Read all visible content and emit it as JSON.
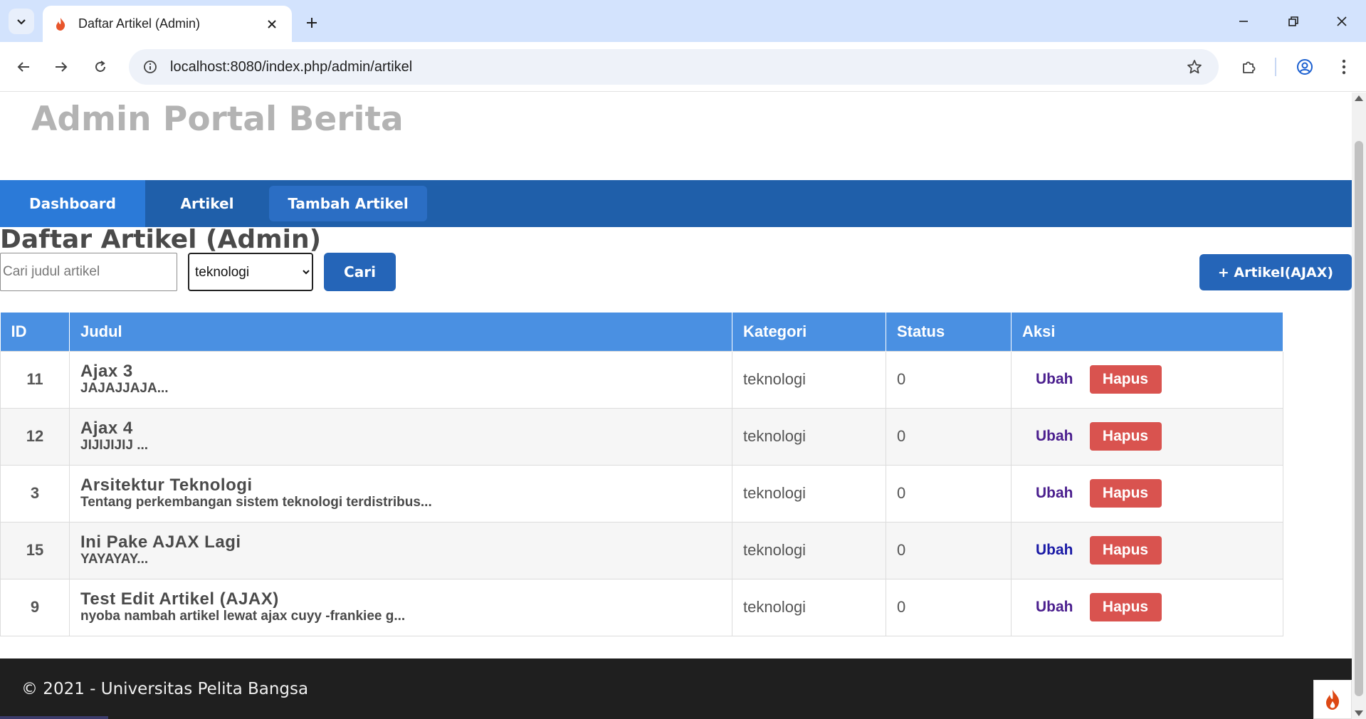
{
  "browser": {
    "tab_title": "Daftar Artikel (Admin)",
    "url": "localhost:8080/index.php/admin/artikel",
    "icons": {
      "tab_list": "chevron-down-icon",
      "favicon": "flame-icon",
      "close_tab": "close-icon",
      "new_tab": "plus-icon",
      "minimize": "minimize-icon",
      "restore": "restore-icon",
      "close_window": "close-icon",
      "back": "arrow-left-icon",
      "forward": "arrow-right-icon",
      "reload": "reload-icon",
      "site_info": "info-icon",
      "bookmark": "star-icon",
      "extensions": "puzzle-icon",
      "profile": "profile-icon",
      "menu": "more-vertical-icon"
    }
  },
  "site": {
    "title": "Admin Portal Berita"
  },
  "nav": {
    "dashboard": "Dashboard",
    "artikel": "Artikel",
    "tambah_artikel": "Tambah Artikel"
  },
  "page": {
    "heading": "Daftar Artikel (Admin)"
  },
  "filters": {
    "search_placeholder": "Cari judul artikel",
    "search_value": "",
    "category_selected": "teknologi",
    "search_button": "Cari",
    "add_ajax_button": "+ Artikel(AJAX)"
  },
  "table": {
    "headers": {
      "id": "ID",
      "judul": "Judul",
      "kategori": "Kategori",
      "status": "Status",
      "aksi": "Aksi"
    },
    "rows": [
      {
        "id": "11",
        "title": "Ajax 3",
        "excerpt": "JAJAJJAJA...",
        "kategori": "teknologi",
        "status": "0",
        "edit": "Ubah",
        "delete": "Hapus"
      },
      {
        "id": "12",
        "title": "Ajax 4",
        "excerpt": "JIJIJIJIJ ...",
        "kategori": "teknologi",
        "status": "0",
        "edit": "Ubah",
        "delete": "Hapus"
      },
      {
        "id": "3",
        "title": "Arsitektur Teknologi",
        "excerpt": "Tentang perkembangan sistem teknologi terdistribus...",
        "kategori": "teknologi",
        "status": "0",
        "edit": "Ubah",
        "delete": "Hapus"
      },
      {
        "id": "15",
        "title": "Ini Pake AJAX Lagi",
        "excerpt": "YAYAYAY...",
        "kategori": "teknologi",
        "status": "0",
        "edit": "Ubah",
        "delete": "Hapus"
      },
      {
        "id": "9",
        "title": "Test Edit Artikel (AJAX)",
        "excerpt": "nyoba nambah artikel lewat ajax cuyy -frankiee g...",
        "kategori": "teknologi",
        "status": "0",
        "edit": "Ubah",
        "delete": "Hapus"
      }
    ]
  },
  "footer": {
    "text": "© 2021 - Universitas Pelita Bangsa"
  },
  "colors": {
    "navbar": "#1f5faa",
    "nav_active": "#2b7ad8",
    "table_header": "#4a90e2",
    "primary_button": "#2565b8",
    "danger_button": "#d9534f",
    "footer": "#1f1f1f"
  }
}
